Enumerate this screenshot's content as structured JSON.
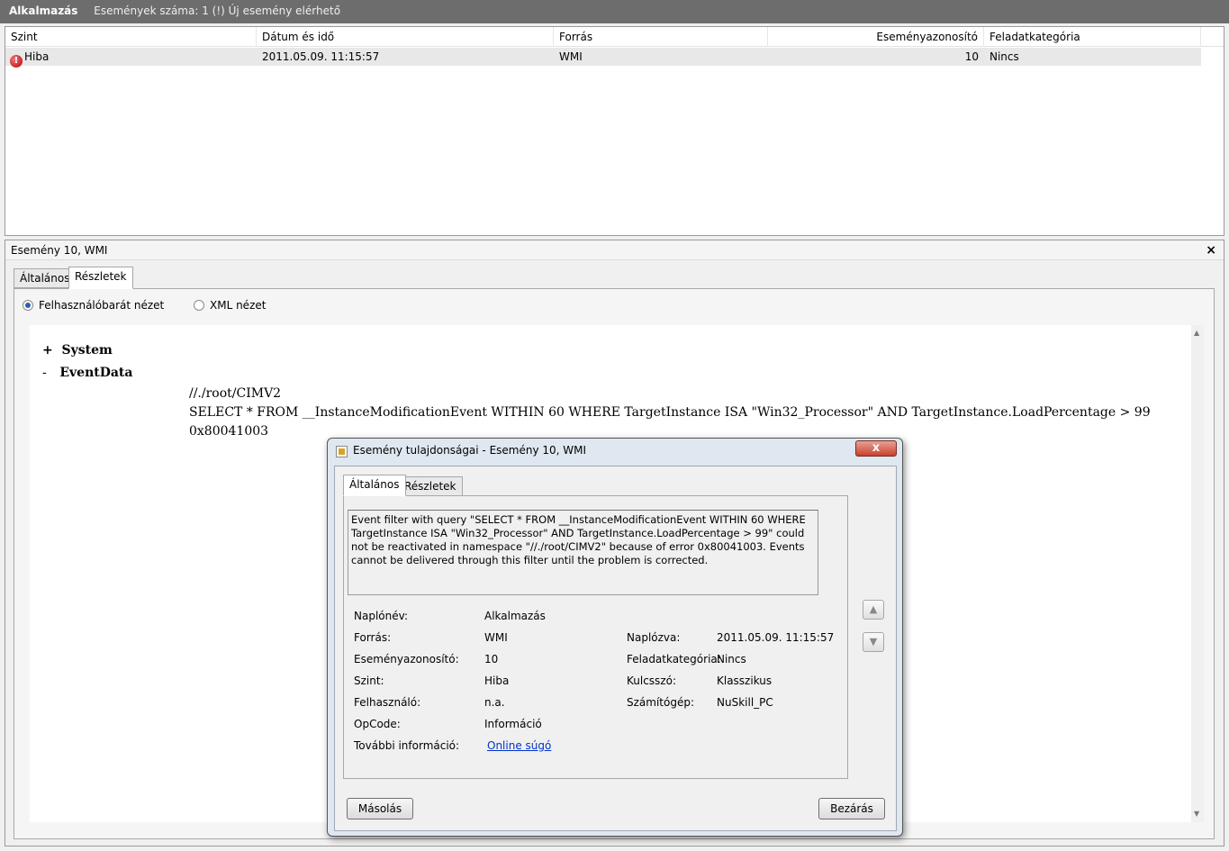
{
  "titlebar": {
    "log_name": "Alkalmazás",
    "event_count": "Események száma: 1 (!) Új esemény elérhető"
  },
  "table": {
    "headers": [
      "Szint",
      "Dátum és idő",
      "Forrás",
      "Eseményazonosító",
      "Feladatkategória"
    ],
    "rows": [
      {
        "level": "Hiba",
        "datetime": "2011.05.09. 11:15:57",
        "source": "WMI",
        "event_id": "10",
        "category": "Nincs"
      }
    ]
  },
  "detail": {
    "title": "Esemény 10, WMI",
    "close": "×",
    "tabs": [
      "Általános",
      "Részletek"
    ],
    "radio_friendly": "Felhasználóbarát nézet",
    "radio_xml": "XML nézet",
    "nodes": {
      "system_prefix": "+",
      "system": "System",
      "eventdata_prefix": "-",
      "eventdata": "EventData"
    },
    "values": [
      "//./root/CIMV2",
      "SELECT * FROM __InstanceModificationEvent WITHIN 60 WHERE TargetInstance ISA \"Win32_Processor\" AND TargetInstance.LoadPercentage > 99",
      "0x80041003"
    ]
  },
  "dialog": {
    "title": "Esemény tulajdonságai - Esemény 10, WMI",
    "close": "x",
    "tabs": [
      "Általános",
      "Részletek"
    ],
    "message": "Event filter with query \"SELECT * FROM __InstanceModificationEvent WITHIN 60 WHERE TargetInstance ISA \"Win32_Processor\" AND TargetInstance.LoadPercentage > 99\" could not be reactivated in namespace \"//./root/CIMV2\" because of error 0x80041003. Events cannot be delivered through this filter until the problem is corrected.",
    "fields": {
      "log_label": "Naplónév:",
      "log_value": "Alkalmazás",
      "source_label": "Forrás:",
      "source_value": "WMI",
      "logged_label": "Naplózva:",
      "logged_value": "2011.05.09. 11:15:57",
      "id_label": "Eseményazonosító:",
      "id_value": "10",
      "category_label": "Feladatkategória:",
      "category_value": "Nincs",
      "level_label": "Szint:",
      "level_value": "Hiba",
      "keyword_label": "Kulcsszó:",
      "keyword_value": "Klasszikus",
      "user_label": "Felhasználó:",
      "user_value": "n.a.",
      "computer_label": "Számítógép:",
      "computer_value": "NuSkill_PC",
      "opcode_label": "OpCode:",
      "opcode_value": "Információ",
      "more_label": "További információ:",
      "more_link": "Online súgó"
    },
    "copy_button": "Másolás",
    "close_button": "Bezárás"
  }
}
